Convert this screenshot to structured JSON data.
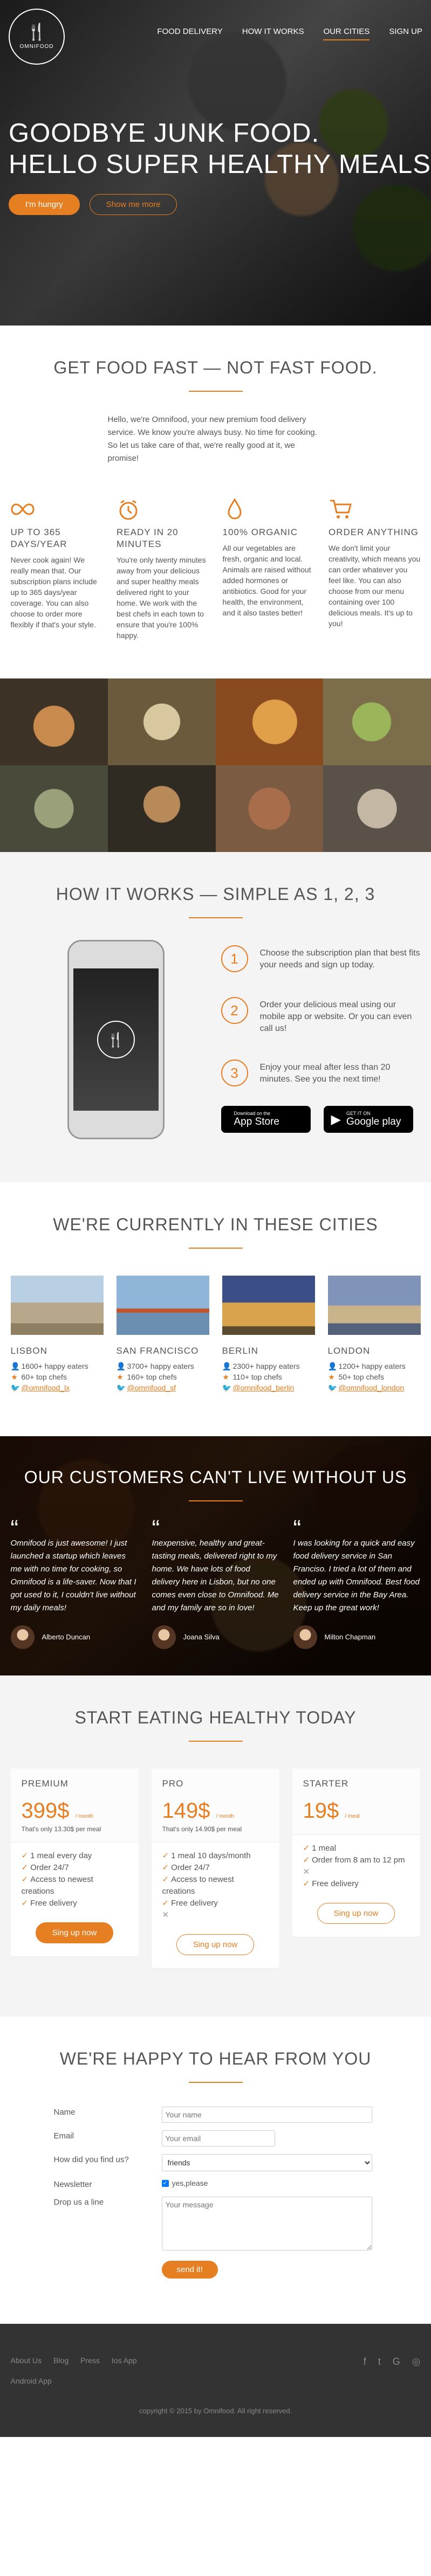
{
  "brand": {
    "logo_text": "OMNIFOOD",
    "accent": "#e67e22"
  },
  "nav": {
    "items": [
      {
        "label": "Food delivery"
      },
      {
        "label": "How it works"
      },
      {
        "label": "Our cities"
      },
      {
        "label": "Sign up"
      }
    ]
  },
  "hero": {
    "line1": "Goodbye junk food.",
    "line2": "Hello super healthy meals.",
    "cta_primary": "I'm hungry",
    "cta_secondary": "Show me more"
  },
  "features": {
    "title": "Get food fast — not fast food.",
    "intro": "Hello, we're Omnifood, your new premium food delivery service. We know you're always busy. No time for cooking. So let us take care of that, we're really good at it, we promise!",
    "items": [
      {
        "icon": "infinity-icon",
        "title": "Up to 365 days/year",
        "text": "Never cook again! We really mean that. Our subscription plans include up to 365 days/year coverage. You can also choose to order more flexibly if that's your style."
      },
      {
        "icon": "stopwatch-icon",
        "title": "Ready in 20 minutes",
        "text": "You're only twenty minutes away from your delicious and super healthy meals delivered right to your home. We work with the best chefs in each town to ensure that you're 100% happy."
      },
      {
        "icon": "leaf-icon",
        "title": "100% organic",
        "text": "All our vegetables are fresh, organic and local. Animals are raised without added hormones or antibiotics. Good for your health, the environment, and it also tastes better!"
      },
      {
        "icon": "cart-icon",
        "title": "Order anything",
        "text": "We don't limit your creativity, which means you can order whatever you feel like. You can also choose from our menu containing over 100 delicious meals. It's up to you!"
      }
    ]
  },
  "meals": [
    "#3d3226",
    "#6b5a3b",
    "#8a4a1f",
    "#7c6d4b",
    "#4a4a3a",
    "#2f2a22",
    "#7b5b42",
    "#5a5248"
  ],
  "steps": {
    "title": "How it works — Simple as 1, 2, 3",
    "items": [
      {
        "num": "1",
        "text": "Choose the subscription plan that best fits your needs and sign up today."
      },
      {
        "num": "2",
        "text": "Order your delicious meal using our mobile app or website. Or you can even call us!"
      },
      {
        "num": "3",
        "text": "Enjoy your meal after less than 20 minutes. See you the next time!"
      }
    ],
    "appstore_small": "Download on the",
    "appstore_big": "App Store",
    "googleplay_small": "GET IT ON",
    "googleplay_big": "Google play"
  },
  "cities": {
    "title": "We're currently in these cities",
    "items": [
      {
        "name": "Lisbon",
        "eaters": "1600+ happy eaters",
        "chefs": "60+ top chefs",
        "twitter": "@omnifood_lx",
        "color": "#b7a88c"
      },
      {
        "name": "San Francisco",
        "eaters": "3700+ happy eaters",
        "chefs": "160+ top chefs",
        "twitter": "@omnifood_sf",
        "color": "#c0542b"
      },
      {
        "name": "Berlin",
        "eaters": "2300+ happy eaters",
        "chefs": "110+ top chefs",
        "twitter": "@omnifood_berlin",
        "color": "#3b4f86"
      },
      {
        "name": "London",
        "eaters": "1200+ happy eaters",
        "chefs": "50+ top chefs",
        "twitter": "@omnifood_london",
        "color": "#7f94b8"
      }
    ]
  },
  "testimonials": {
    "title": "Our customers can't live without us",
    "items": [
      {
        "quote": "Omnifood is just awesome! I just launched a startup which leaves me with no time for cooking, so Omnifood is a life-saver. Now that I got used to it, I couldn't live without my daily meals!",
        "name": "Alberto Duncan"
      },
      {
        "quote": "Inexpensive, healthy and great-tasting meals, delivered right to my home. We have lots of food delivery here in Lisbon, but no one comes even close to Omnifood. Me and my family are so in love!",
        "name": "Joana Silva"
      },
      {
        "quote": "I was looking for a quick and easy food delivery service in San Franciso. I tried a lot of them and ended up with Omnifood. Best food delivery service in the Bay Area. Keep up the great work!",
        "name": "Milton Chapman"
      }
    ]
  },
  "plans": {
    "title": "Start eating healthy today",
    "items": [
      {
        "name": "Premium",
        "price": "399$",
        "unit": "/ month",
        "per": "That's only 13.30$ per meal",
        "features": [
          {
            "ok": true,
            "text": "1 meal every day"
          },
          {
            "ok": true,
            "text": "Order 24/7"
          },
          {
            "ok": true,
            "text": "Access to newest creations"
          },
          {
            "ok": true,
            "text": "Free delivery"
          }
        ],
        "cta": "Sing up now",
        "full": true
      },
      {
        "name": "Pro",
        "price": "149$",
        "unit": "/ month",
        "per": "That's only 14.90$ per meal",
        "features": [
          {
            "ok": true,
            "text": "1 meal 10 days/month"
          },
          {
            "ok": true,
            "text": "Order 24/7"
          },
          {
            "ok": true,
            "text": "Access to newest creations"
          },
          {
            "ok": true,
            "text": "Free delivery"
          },
          {
            "ok": false,
            "text": ""
          }
        ],
        "cta": "Sing up now",
        "full": false
      },
      {
        "name": "Starter",
        "price": "19$",
        "unit": "/ meal",
        "per": "",
        "features": [
          {
            "ok": true,
            "text": "1 meal"
          },
          {
            "ok": true,
            "text": "Order from 8 am to 12 pm"
          },
          {
            "ok": false,
            "text": ""
          },
          {
            "ok": true,
            "text": "Free delivery"
          }
        ],
        "cta": "Sing up now",
        "full": false
      }
    ]
  },
  "contact": {
    "title": "We're happy to hear from you",
    "name_label": "Name",
    "name_placeholder": "Your name",
    "email_label": "Email",
    "email_placeholder": "Your email",
    "find_label": "How did you find us?",
    "find_value": "friends",
    "news_label": "Newsletter",
    "news_value": "yes,please",
    "message_label": "Drop us a line",
    "message_placeholder": "Your message",
    "send": "send it!"
  },
  "footer": {
    "links": [
      "About Us",
      "Blog",
      "Press",
      "Ios App",
      "Android App"
    ],
    "social": [
      "facebook-icon",
      "twitter-icon",
      "google-plus-icon",
      "instagram-icon"
    ],
    "copyright": "copyright © 2015 by Omnifood. All right reserved."
  }
}
